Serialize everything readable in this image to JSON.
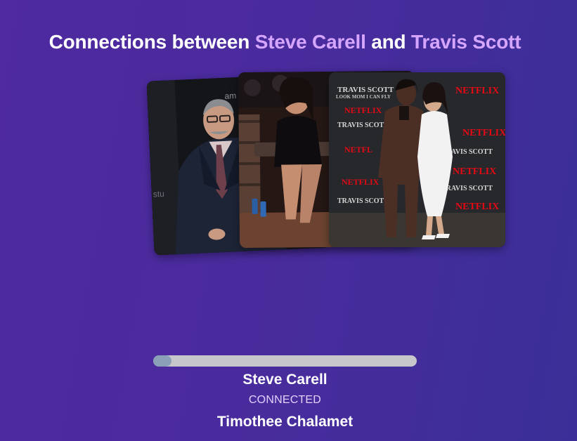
{
  "header": {
    "prefix": "Connections between ",
    "person_a": "Steve Carell",
    "joiner": " and ",
    "person_b": "Travis Scott"
  },
  "photos": [
    {
      "subject": "Steve Carell",
      "backdrop_text": "am"
    },
    {
      "subject": "Kylie Jenner"
    },
    {
      "subject": "Travis Scott and Kylie Jenner",
      "backdrop_brand": "NETFLIX",
      "backdrop_text": "TRAVIS SCOTT",
      "backdrop_subtext": "LOOK MOM I CAN FLY"
    }
  ],
  "progress": {
    "fraction": 0.07
  },
  "chain": {
    "from": "Steve Carell",
    "status": "CONNECTED",
    "to": "Timothee Chalamet"
  },
  "colors": {
    "accent_name": "#d6a6ff",
    "status": "#e4cffd",
    "progress_track": "#c7c7cb",
    "progress_fill": "#8aa0b8",
    "netflix_red": "#e50914"
  }
}
